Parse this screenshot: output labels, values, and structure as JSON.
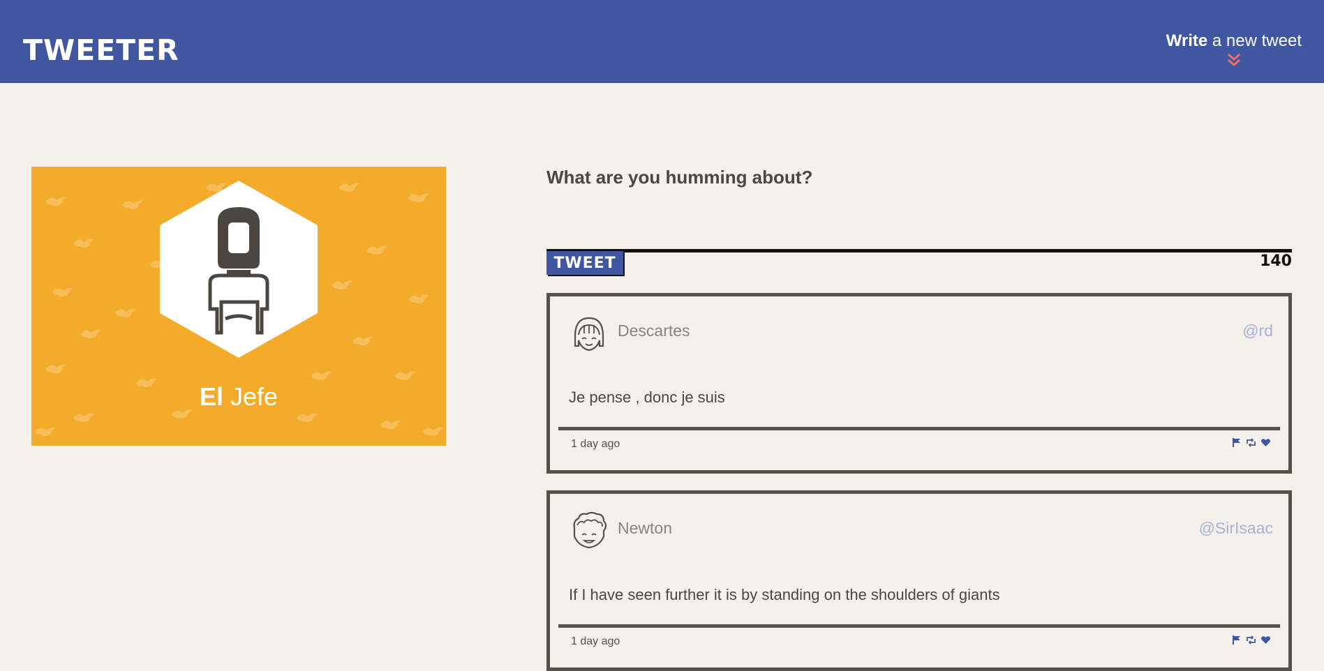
{
  "nav": {
    "brand": "TWEETER",
    "compose_strong": "Write",
    "compose_rest": " a new tweet"
  },
  "profile": {
    "first_name": "El",
    "last_name": " Jefe"
  },
  "composer": {
    "label": "What are you humming about?",
    "button_label": "TWEET",
    "counter": "140"
  },
  "tweets": [
    {
      "name": "Descartes",
      "handle": "@rd",
      "text": "Je pense , donc je suis",
      "time": "1 day ago"
    },
    {
      "name": "Newton",
      "handle": "@SirIsaac",
      "text": "If I have seen further it is by standing on the shoulders of giants",
      "time": "1 day ago"
    }
  ],
  "colors": {
    "nav_bg": "#4056a1",
    "accent": "#f76c6c",
    "profile_bg": "#f5ab2a",
    "page_bg": "#f4f1ec",
    "text_dark": "#4a4642",
    "handle": "#a9b0d6"
  },
  "icons": [
    "chevrons-down-icon",
    "flag-icon",
    "retweet-icon",
    "heart-icon"
  ]
}
